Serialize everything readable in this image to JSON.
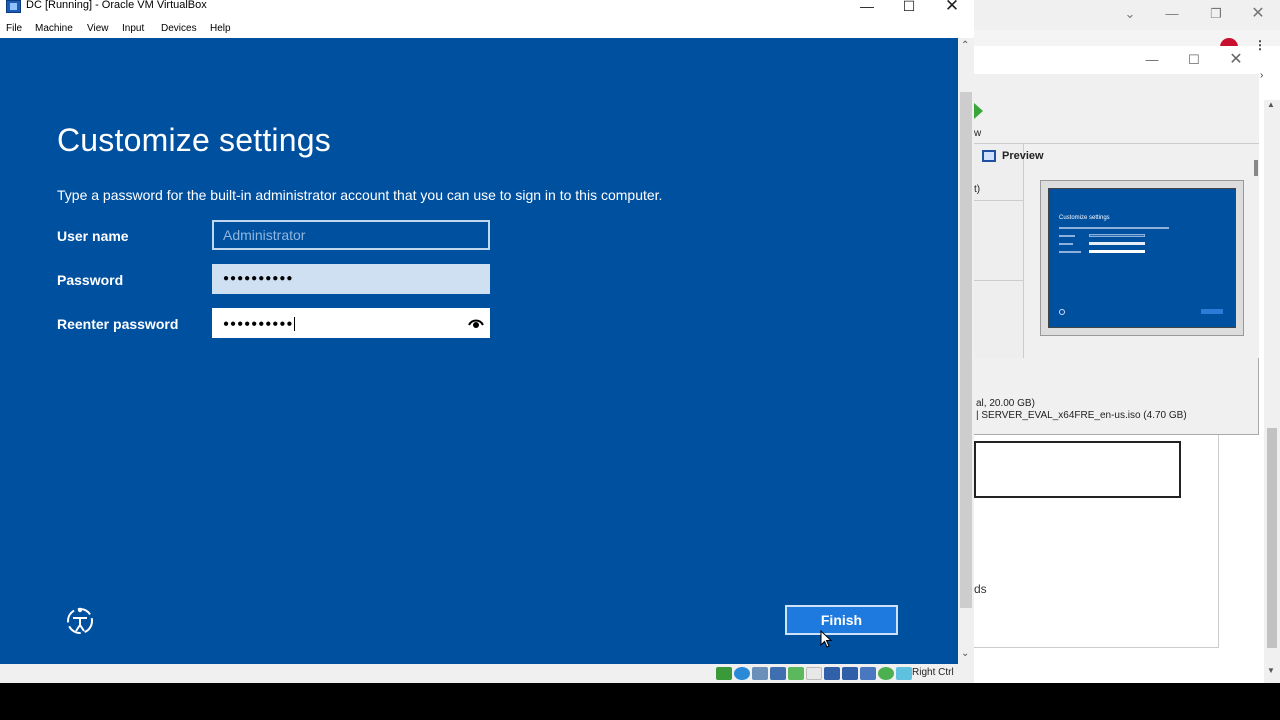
{
  "vbox": {
    "title": "DC [Running] - Oracle VM VirtualBox",
    "menu": [
      "File",
      "Machine",
      "View",
      "Input",
      "Devices",
      "Help"
    ],
    "host_key": "Right Ctrl"
  },
  "setup": {
    "title": "Customize settings",
    "description": "Type a password for the built-in administrator account that you can use to sign in to this computer.",
    "username_label": "User name",
    "username_placeholder": "Administrator",
    "password_label": "Password",
    "password_value": "●●●●●●●●●●",
    "reenter_label": "Reenter password",
    "reenter_value": "●●●●●●●●●●",
    "finish_label": "Finish"
  },
  "background": {
    "preview_label": "Preview",
    "toolbar_fragment": "w",
    "list_fragment": "t)",
    "storage_line1": "al, 20.00 GB)",
    "storage_line2": "| SERVER_EVAL_x64FRE_en-us.iso (4.70 GB)",
    "fragment_ds": "ds"
  },
  "icons": {
    "app": "virtualbox-icon",
    "reveal": "eye-icon",
    "ease_of_access": "ease-of-access-icon"
  },
  "colors": {
    "setup_background": "#0050a0",
    "finish_button": "#1f7ae0"
  }
}
